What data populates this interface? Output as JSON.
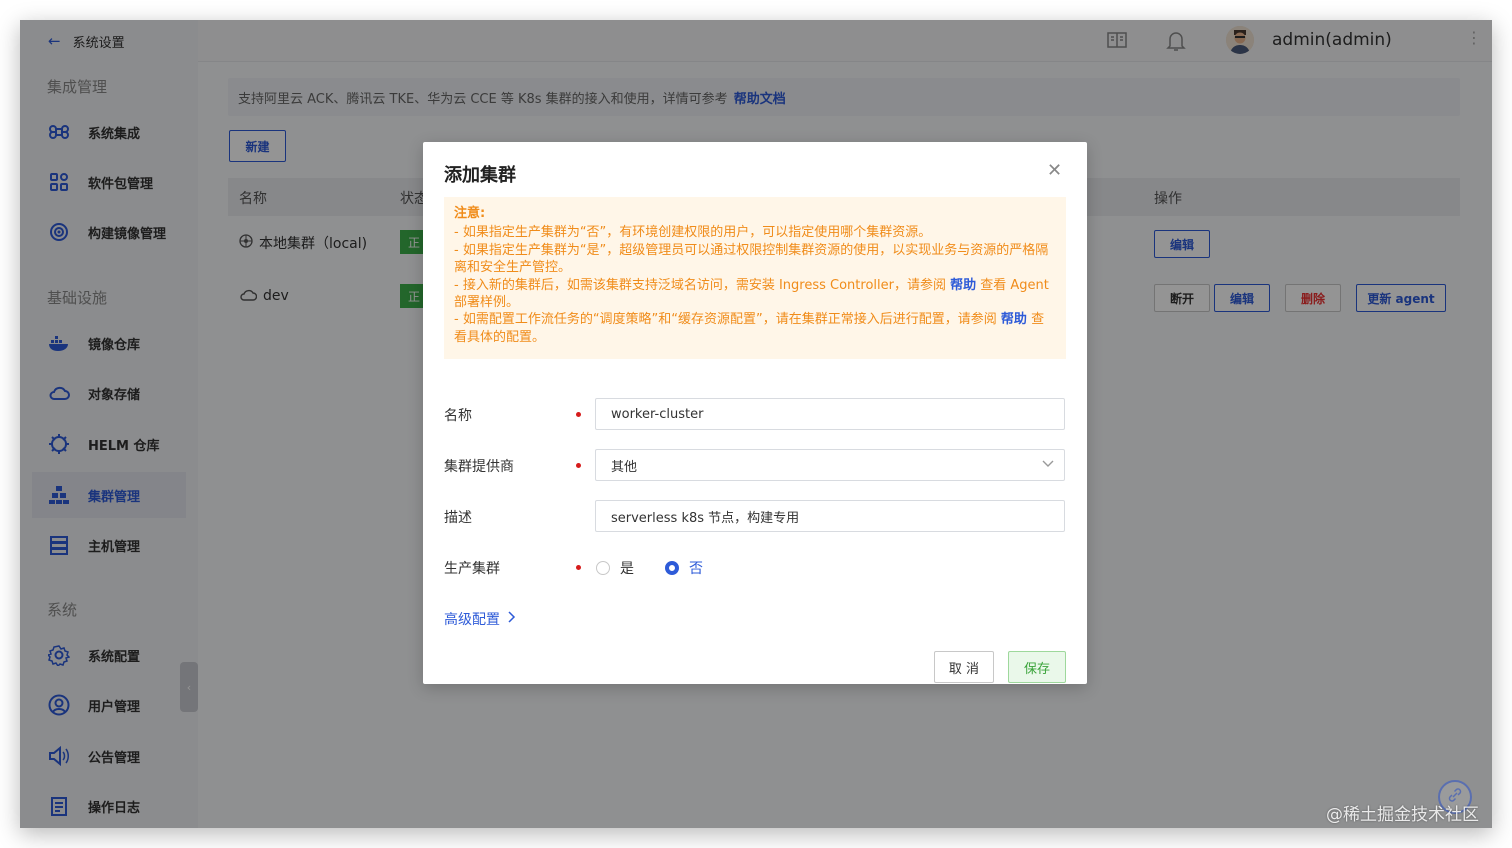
{
  "sidebar": {
    "back_label": "系统设置",
    "sections": [
      {
        "title": "集成管理"
      },
      {
        "title": "基础设施"
      },
      {
        "title": "系统"
      }
    ],
    "items": [
      {
        "label": "系统集成",
        "icon": "command-icon"
      },
      {
        "label": "软件包管理",
        "icon": "grid-icon"
      },
      {
        "label": "构建镜像管理",
        "icon": "target-icon"
      },
      {
        "label": "镜像仓库",
        "icon": "docker-icon"
      },
      {
        "label": "对象存储",
        "icon": "cloud-icon"
      },
      {
        "label": "HELM 仓库",
        "icon": "helm-icon"
      },
      {
        "label": "集群管理",
        "icon": "cluster-icon",
        "active": true
      },
      {
        "label": "主机管理",
        "icon": "server-icon"
      },
      {
        "label": "系统配置",
        "icon": "gear-icon"
      },
      {
        "label": "用户管理",
        "icon": "user-icon"
      },
      {
        "label": "公告管理",
        "icon": "speaker-icon"
      },
      {
        "label": "操作日志",
        "icon": "log-icon"
      }
    ]
  },
  "header": {
    "user": "admin(admin)"
  },
  "main": {
    "notice_text": "支持阿里云 ACK、腾讯云 TKE、华为云 CCE 等 K8s 集群的接入和使用，详情可参考",
    "notice_link": "帮助文档",
    "new_button": "新建",
    "columns": {
      "name": "名称",
      "status": "状态",
      "ops": "操作"
    },
    "rows": [
      {
        "name": "本地集群（local)",
        "status": "正",
        "ops": [
          "编辑"
        ]
      },
      {
        "name": "dev",
        "status": "正",
        "ops": [
          "断开",
          "编辑",
          "删除",
          "更新 agent"
        ]
      }
    ]
  },
  "modal": {
    "title": "添加集群",
    "warning": {
      "title": "注意:",
      "line1": "- 如果指定生产集群为“否”，有环境创建权限的用户，可以指定使用哪个集群资源。",
      "line2": "- 如果指定生产集群为“是”，超级管理员可以通过权限控制集群资源的使用，以实现业务与资源的严格隔离和安全生产管控。",
      "line3_a": "- 接入新的集群后，如需该集群支持泛域名访问，需安装 Ingress Controller，请参阅",
      "line3_link": "帮助",
      "line3_b": "查看 Agent 部署样例。",
      "line4_a": "- 如需配置工作流任务的“调度策略”和“缓存资源配置”，请在集群正常接入后进行配置，请参阅",
      "line4_link": "帮助",
      "line4_b": "查看具体的配置。"
    },
    "fields": {
      "name_label": "名称",
      "name_value": "worker-cluster",
      "provider_label": "集群提供商",
      "provider_value": "其他",
      "desc_label": "描述",
      "desc_value": "serverless k8s 节点，构建专用",
      "prod_label": "生产集群",
      "prod_yes": "是",
      "prod_no": "否",
      "prod_selected": "否"
    },
    "advanced_label": "高级配置",
    "cancel_label": "取 消",
    "save_label": "保存"
  },
  "watermark": "@稀土掘金技术社区",
  "colors": {
    "accent": "#2e5bd8",
    "warning": "#f08c1a",
    "success": "#3db04b",
    "danger": "#d61c1c"
  }
}
